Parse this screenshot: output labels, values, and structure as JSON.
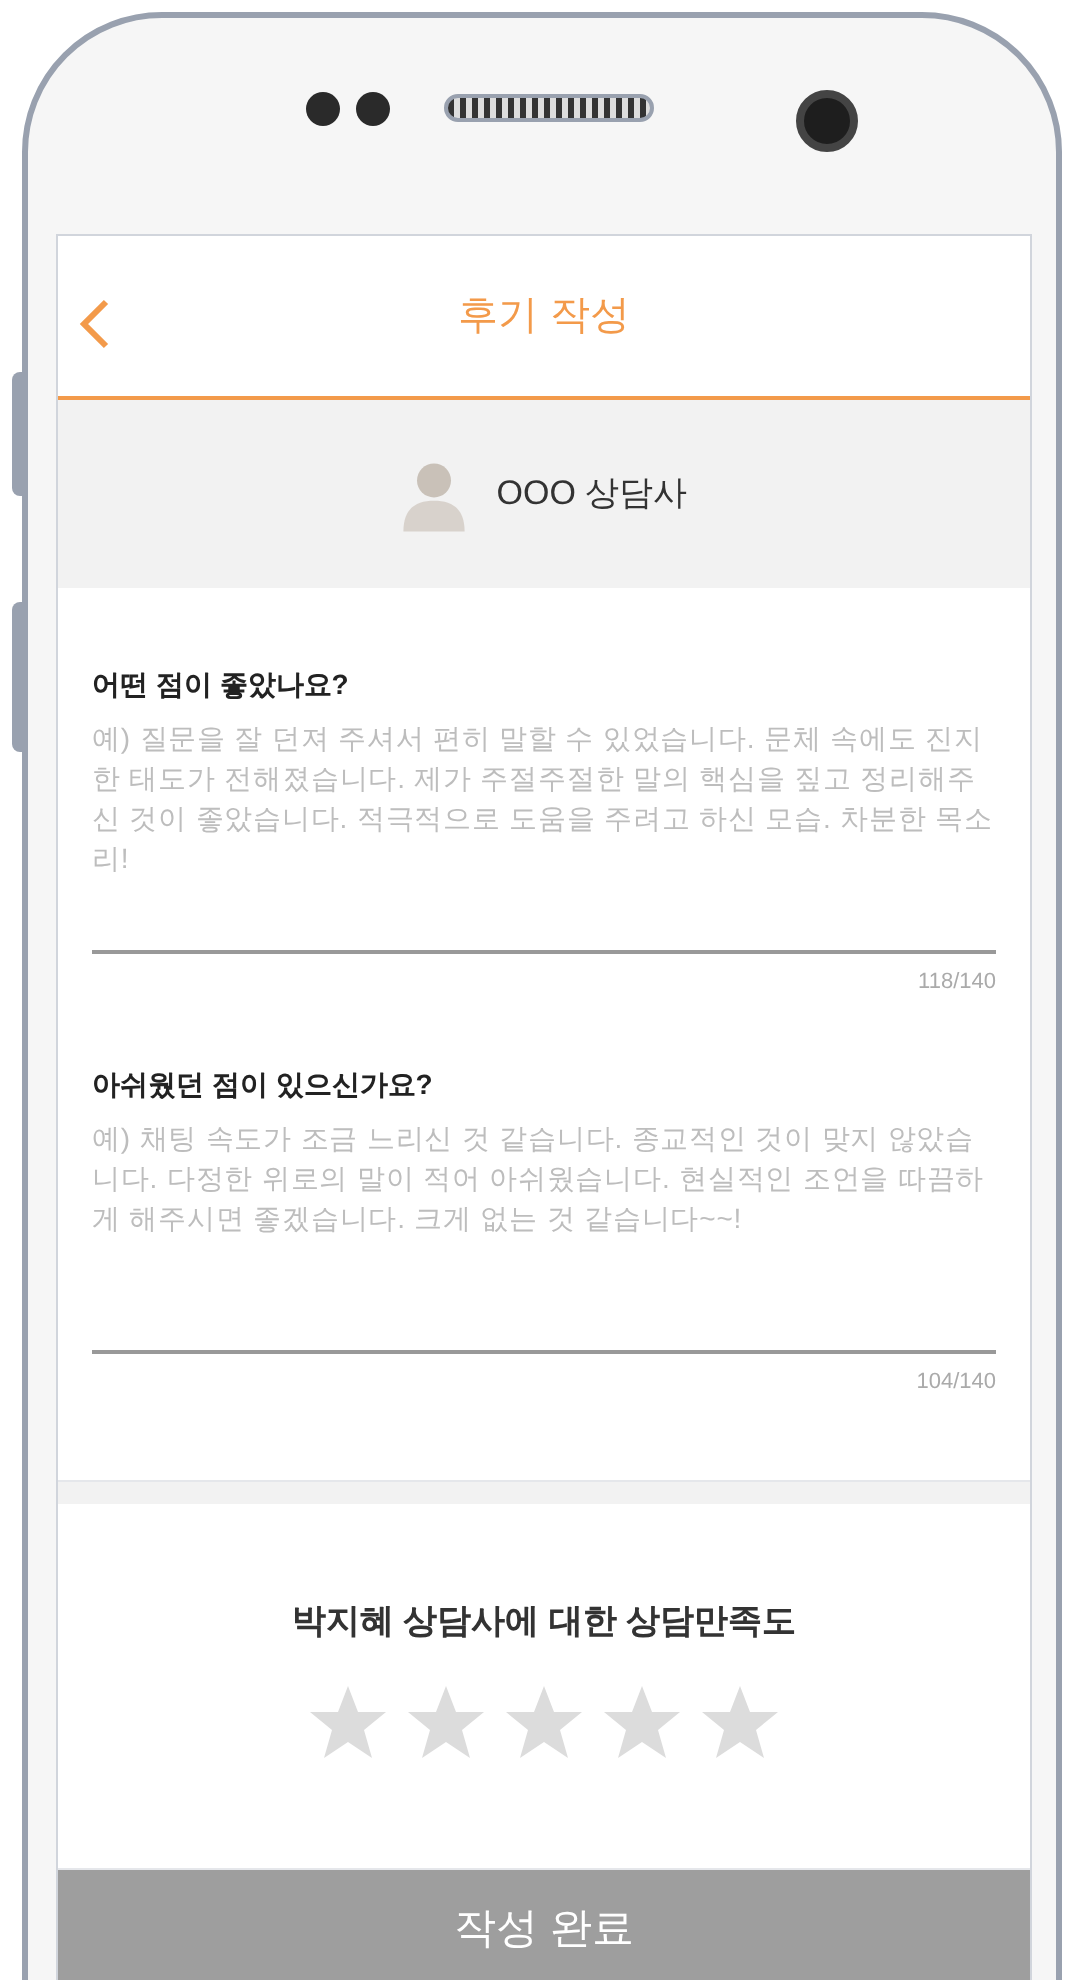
{
  "header": {
    "title": "후기 작성"
  },
  "counselor": {
    "name": "OOO 상담사"
  },
  "questions": [
    {
      "title": "어떤 점이 좋았나요?",
      "placeholder": "예) 질문을 잘 던져 주셔서 편히 말할 수 있었습니다. 문체 속에도 진지한 태도가 전해졌습니다. 제가 주절주절한 말의 핵심을 짚고 정리해주신 것이 좋았습니다. 적극적으로 도움을 주려고 하신 모습. 차분한 목소리!",
      "counter": "118/140"
    },
    {
      "title": "아쉬웠던 점이 있으신가요?",
      "placeholder": "예) 채팅 속도가 조금 느리신 것 같습니다. 종교적인 것이 맞지 않았습니다. 다정한 위로의 말이 적어 아쉬웠습니다. 현실적인 조언을 따끔하게 해주시면 좋겠습니다. 크게 없는 것 같습니다~~!",
      "counter": "104/140"
    }
  ],
  "rating": {
    "title": "박지혜 상담사에 대한 상담만족도",
    "stars": 0
  },
  "submit_button": "작성 완료"
}
